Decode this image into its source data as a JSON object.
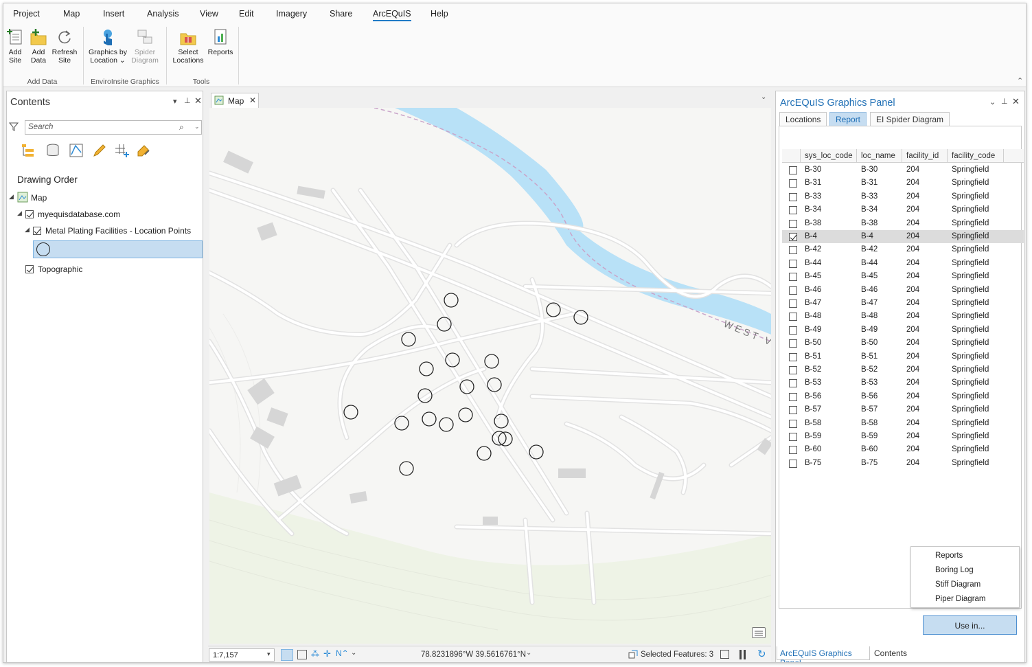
{
  "menu": {
    "items": [
      "Project",
      "Map",
      "Insert",
      "Analysis",
      "View",
      "Edit",
      "Imagery",
      "Share",
      "ArcEQuIS",
      "Help"
    ],
    "active": "ArcEQuIS"
  },
  "ribbon": {
    "groups": [
      {
        "label": "Add Data",
        "buttons": [
          {
            "line1": "Add",
            "line2": "Site"
          },
          {
            "line1": "Add",
            "line2": "Data"
          },
          {
            "line1": "Refresh",
            "line2": "Site"
          }
        ]
      },
      {
        "label": "EnviroInsite Graphics",
        "buttons": [
          {
            "line1": "Graphics by",
            "line2": "Location"
          },
          {
            "line1": "Spider",
            "line2": "Diagram"
          }
        ]
      },
      {
        "label": "Tools",
        "buttons": [
          {
            "line1": "Select",
            "line2": "Locations"
          },
          {
            "line1": "Reports",
            "line2": ""
          }
        ]
      }
    ]
  },
  "contents": {
    "title": "Contents",
    "search_placeholder": "Search",
    "drawing_order": "Drawing Order",
    "layers": {
      "map": "Map",
      "db": "myequisdatabase.com",
      "points": "Metal Plating Facilities - Location Points",
      "topo": "Topographic"
    }
  },
  "map_tab": {
    "label": "Map"
  },
  "map_labels": {
    "road": "WEST VI"
  },
  "statusbar": {
    "scale": "1:7,157",
    "coords": "78.8231896°W 39.5616761°N",
    "selected": "Selected Features: 3"
  },
  "panel": {
    "title": "ArcEQuIS Graphics Panel",
    "tabs": [
      "Locations",
      "Report",
      "EI Spider Diagram"
    ],
    "active_tab": "Report",
    "columns": [
      "sys_loc_code",
      "loc_name",
      "facility_id",
      "facility_code"
    ],
    "rows": [
      [
        "B-30",
        "B-30",
        "204",
        "Springfield"
      ],
      [
        "B-31",
        "B-31",
        "204",
        "Springfield"
      ],
      [
        "B-33",
        "B-33",
        "204",
        "Springfield"
      ],
      [
        "B-34",
        "B-34",
        "204",
        "Springfield"
      ],
      [
        "B-38",
        "B-38",
        "204",
        "Springfield"
      ],
      [
        "B-4",
        "B-4",
        "204",
        "Springfield"
      ],
      [
        "B-42",
        "B-42",
        "204",
        "Springfield"
      ],
      [
        "B-44",
        "B-44",
        "204",
        "Springfield"
      ],
      [
        "B-45",
        "B-45",
        "204",
        "Springfield"
      ],
      [
        "B-46",
        "B-46",
        "204",
        "Springfield"
      ],
      [
        "B-47",
        "B-47",
        "204",
        "Springfield"
      ],
      [
        "B-48",
        "B-48",
        "204",
        "Springfield"
      ],
      [
        "B-49",
        "B-49",
        "204",
        "Springfield"
      ],
      [
        "B-50",
        "B-50",
        "204",
        "Springfield"
      ],
      [
        "B-51",
        "B-51",
        "204",
        "Springfield"
      ],
      [
        "B-52",
        "B-52",
        "204",
        "Springfield"
      ],
      [
        "B-53",
        "B-53",
        "204",
        "Springfield"
      ],
      [
        "B-56",
        "B-56",
        "204",
        "Springfield"
      ],
      [
        "B-57",
        "B-57",
        "204",
        "Springfield"
      ],
      [
        "B-58",
        "B-58",
        "204",
        "Springfield"
      ],
      [
        "B-59",
        "B-59",
        "204",
        "Springfield"
      ],
      [
        "B-60",
        "B-60",
        "204",
        "Springfield"
      ],
      [
        "B-75",
        "B-75",
        "204",
        "Springfield"
      ]
    ],
    "checked_row": "B-4",
    "context_menu": [
      "Reports",
      "Boring Log",
      "Stiff Diagram",
      "Piper Diagram"
    ],
    "use_in": "Use in...",
    "bottom_tabs": [
      "ArcEQuIS Graphics Panel",
      "Contents"
    ]
  },
  "colors": {
    "accent": "#1f7ac6",
    "selection": "#c6ddf1",
    "river": "#b8e1f7"
  }
}
